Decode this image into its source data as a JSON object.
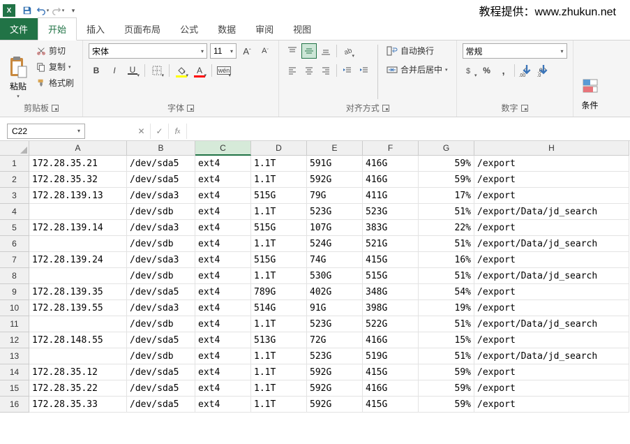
{
  "watermark": "教程提供：www.zhukun.net",
  "tabs": {
    "file": "文件",
    "home": "开始",
    "insert": "插入",
    "layout": "页面布局",
    "formula": "公式",
    "data": "数据",
    "review": "审阅",
    "view": "视图"
  },
  "clipboard": {
    "paste": "粘贴",
    "cut": "剪切",
    "copy": "复制",
    "painter": "格式刷",
    "group": "剪贴板"
  },
  "font": {
    "name": "宋体",
    "size": "11",
    "group": "字体"
  },
  "align": {
    "wrap": "自动换行",
    "merge": "合并后居中",
    "group": "对齐方式"
  },
  "number": {
    "fmt": "常规",
    "group": "数字"
  },
  "cond": "条件",
  "namebox": "C22",
  "columns": [
    "A",
    "B",
    "C",
    "D",
    "E",
    "F",
    "G",
    "H"
  ],
  "colClass": [
    "w-A",
    "w-B",
    "w-C",
    "w-D",
    "w-E",
    "w-F",
    "w-G",
    "w-H"
  ],
  "rows": [
    [
      "172.28.35.21",
      "/dev/sda5",
      "ext4",
      "1.1T",
      "591G",
      "416G",
      "59%",
      "/export"
    ],
    [
      "172.28.35.32",
      "/dev/sda5",
      "ext4",
      "1.1T",
      "592G",
      "416G",
      "59%",
      "/export"
    ],
    [
      "172.28.139.13",
      "/dev/sda3",
      "ext4",
      "515G",
      "79G",
      "411G",
      "17%",
      "/export"
    ],
    [
      "",
      "/dev/sdb",
      "ext4",
      "1.1T",
      "523G",
      "523G",
      "51%",
      "/export/Data/jd_search"
    ],
    [
      "172.28.139.14",
      "/dev/sda3",
      "ext4",
      "515G",
      "107G",
      "383G",
      "22%",
      "/export"
    ],
    [
      "",
      "/dev/sdb",
      "ext4",
      "1.1T",
      "524G",
      "521G",
      "51%",
      "/export/Data/jd_search"
    ],
    [
      "172.28.139.24",
      "/dev/sda3",
      "ext4",
      "515G",
      "74G",
      "415G",
      "16%",
      "/export"
    ],
    [
      "",
      "/dev/sdb",
      "ext4",
      "1.1T",
      "530G",
      "515G",
      "51%",
      "/export/Data/jd_search"
    ],
    [
      "172.28.139.35",
      "/dev/sda5",
      "ext4",
      "789G",
      "402G",
      "348G",
      "54%",
      "/export"
    ],
    [
      "172.28.139.55",
      "/dev/sda3",
      "ext4",
      "514G",
      "91G",
      "398G",
      "19%",
      "/export"
    ],
    [
      "",
      "/dev/sdb",
      "ext4",
      "1.1T",
      "523G",
      "522G",
      "51%",
      "/export/Data/jd_search"
    ],
    [
      "172.28.148.55",
      "/dev/sda5",
      "ext4",
      "513G",
      "72G",
      "416G",
      "15%",
      "/export"
    ],
    [
      "",
      "/dev/sdb",
      "ext4",
      "1.1T",
      "523G",
      "519G",
      "51%",
      "/export/Data/jd_search"
    ],
    [
      "172.28.35.12",
      "/dev/sda5",
      "ext4",
      "1.1T",
      "592G",
      "415G",
      "59%",
      "/export"
    ],
    [
      "172.28.35.22",
      "/dev/sda5",
      "ext4",
      "1.1T",
      "592G",
      "416G",
      "59%",
      "/export"
    ],
    [
      "172.28.35.33",
      "/dev/sda5",
      "ext4",
      "1.1T",
      "592G",
      "415G",
      "59%",
      "/export"
    ]
  ]
}
